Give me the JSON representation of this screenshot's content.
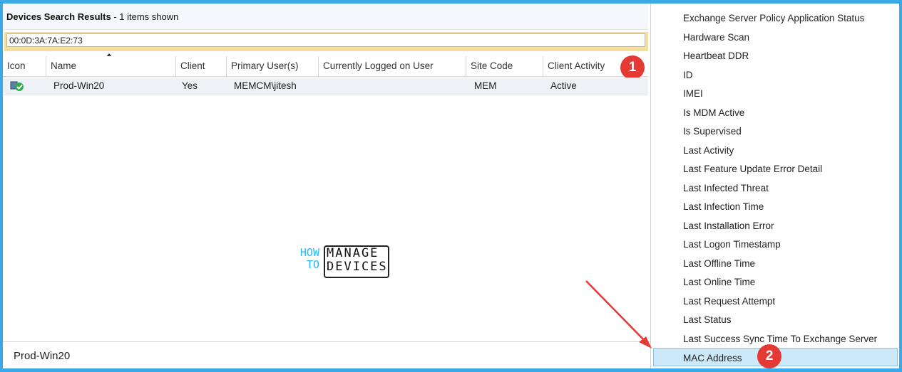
{
  "header": {
    "title_bold": "Devices Search Results",
    "title_rest": " -  1 items shown"
  },
  "search": {
    "value": "00:0D:3A:7A:E2:73"
  },
  "columns": [
    "Icon",
    "Name",
    "Client",
    "Primary User(s)",
    "Currently Logged on User",
    "Site Code",
    "Client Activity"
  ],
  "rows": [
    {
      "icon": "device-icon",
      "name": "Prod-Win20",
      "client": "Yes",
      "primary_user": "MEMCM\\jitesh",
      "logged_on_user": "",
      "site_code": "MEM",
      "client_activity": "Active"
    }
  ],
  "details": {
    "name": "Prod-Win20"
  },
  "badges": {
    "one": "1",
    "two": "2"
  },
  "logo": {
    "how": "HOW",
    "to": "TO",
    "manage": "MANAGE",
    "devices": "DEVICES"
  },
  "menu": {
    "items": [
      "Exchange Server Policy Application Status",
      "Hardware Scan",
      "Heartbeat DDR",
      "ID",
      "IMEI",
      "Is MDM Active",
      "Is Supervised",
      "Last Activity",
      "Last Feature Update Error Detail",
      "Last Infected Threat",
      "Last Infection Time",
      "Last Installation Error",
      "Last Logon Timestamp",
      "Last Offline Time",
      "Last Online Time",
      "Last Request Attempt",
      "Last Status",
      "Last Success Sync Time To Exchange Server"
    ],
    "selected": "MAC Address"
  },
  "colors": {
    "accent_border": "#3aa9e6",
    "badge": "#e53935",
    "selection": "#cde8f8",
    "search_bar": "#f5df9c"
  }
}
